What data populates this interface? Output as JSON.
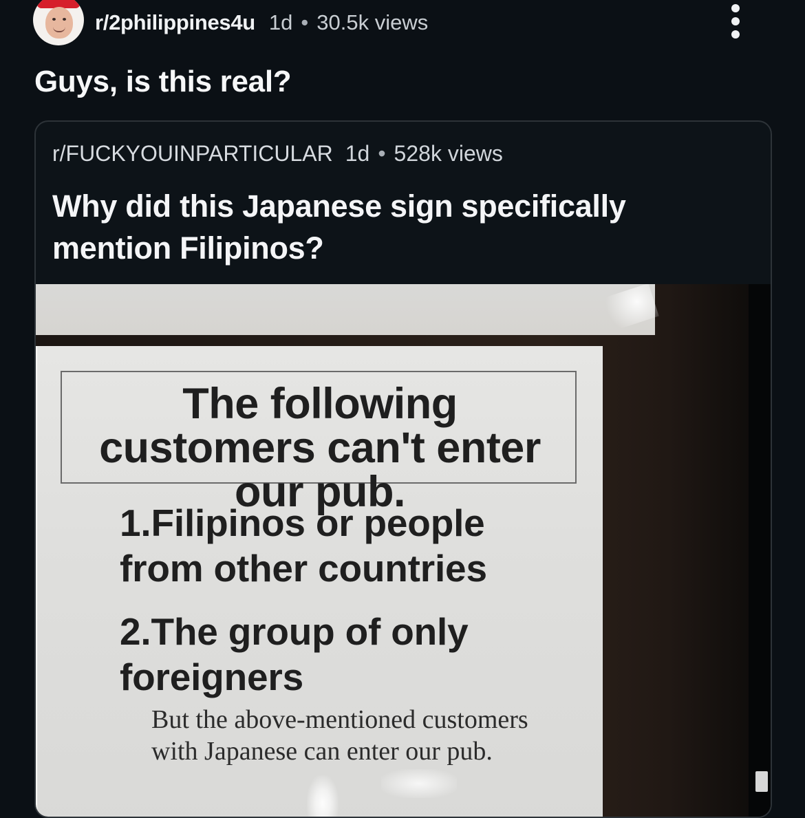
{
  "post": {
    "author_avatar_icon": "avatar-icon",
    "subreddit": "r/2philippines4u",
    "age": "1d",
    "views": "30.5k views",
    "menu_icon": "more-vertical-icon",
    "title": "Guys, is this real?"
  },
  "crosspost": {
    "subreddit": "r/FUCKYOUINPARTICULAR",
    "age": "1d",
    "views": "528k views",
    "title": "Why did this Japanese sign specifically mention Filipinos?",
    "image": {
      "sign_heading": "The following customers\ncan't enter our pub.",
      "item_1": "1.Filipinos or people\n  from other countries",
      "item_2": "2.The group of only\n  foreigners",
      "note": "But the above-mentioned customers\nwith Japanese can enter our pub."
    }
  },
  "colors": {
    "background": "#0b1015",
    "card_border": "#2d3338",
    "text_primary": "#f4f5f7",
    "text_secondary": "#c9ced3"
  }
}
